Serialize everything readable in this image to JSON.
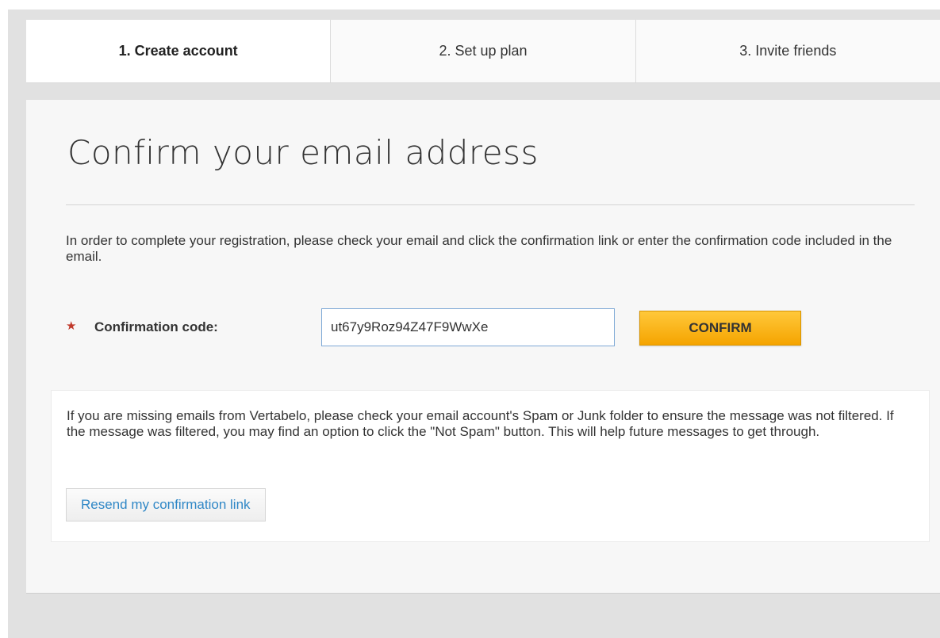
{
  "steps": [
    {
      "label": "1. Create account",
      "active": true
    },
    {
      "label": "2. Set up plan",
      "active": false
    },
    {
      "label": "3. Invite friends",
      "active": false
    }
  ],
  "page": {
    "title": "Confirm your email address",
    "intro": "In order to complete your registration, please check your email and click the confirmation link or enter the confirmation code included in the email."
  },
  "form": {
    "required_marker": "★",
    "label": "Confirmation code:",
    "code_value": "ut67y9Roz94Z47F9WwXe",
    "confirm_label": "CONFIRM"
  },
  "notice": {
    "text": "If you are missing emails from Vertabelo, please check your email account's Spam or Junk folder to ensure the message was not filtered. If the message was filtered, you may find an option to click the \"Not Spam\" button. This will help future messages to get through.",
    "resend_label": "Resend my confirmation link"
  },
  "colors": {
    "accent": "#f5a400",
    "link": "#2f87c6",
    "required": "#c0392b"
  }
}
